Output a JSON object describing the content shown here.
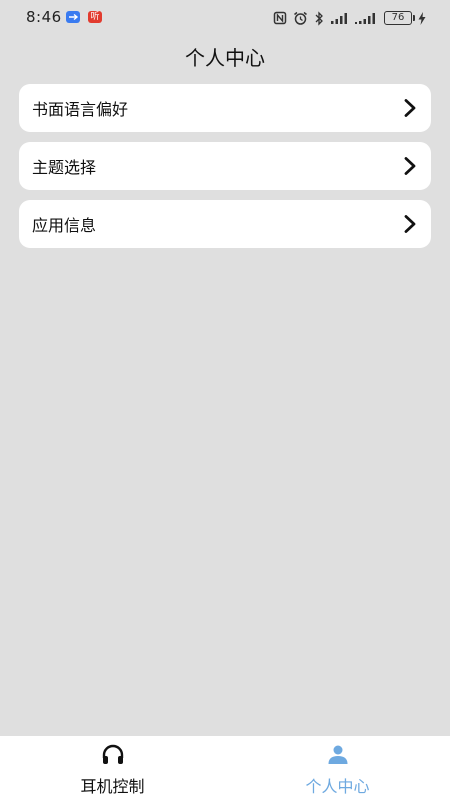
{
  "status_bar": {
    "time": "8:46",
    "app_badge_2": "听",
    "battery": "76"
  },
  "header": {
    "title": "个人中心"
  },
  "menu": {
    "items": [
      {
        "label": "书面语言偏好",
        "icon": "chevron-right-icon"
      },
      {
        "label": "主题选择",
        "icon": "chevron-right-icon"
      },
      {
        "label": "应用信息",
        "icon": "chevron-right-icon"
      }
    ]
  },
  "bottom_nav": {
    "tabs": [
      {
        "label": "耳机控制",
        "icon": "headphones-icon",
        "active": false
      },
      {
        "label": "个人中心",
        "icon": "person-icon",
        "active": true
      }
    ],
    "active_color": "#6ea9e0"
  }
}
